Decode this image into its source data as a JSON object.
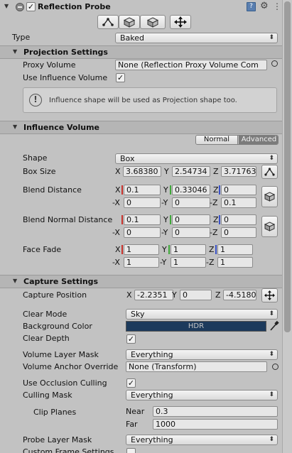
{
  "header": {
    "component_name": "Reflection Probe",
    "help_icon": "book-help-icon",
    "settings_icon": "gear-icon",
    "menu_icon": "vertical-dots-icon"
  },
  "toolbar": {
    "tools": [
      "edit-shape-icon",
      "box-icon",
      "box-icon",
      "move-arrows-icon"
    ]
  },
  "type": {
    "label": "Type",
    "value": "Baked"
  },
  "projection": {
    "title": "Projection Settings",
    "proxy_volume_label": "Proxy Volume",
    "proxy_volume_value": "None (Reflection Proxy Volume Com",
    "use_influence_label": "Use Influence Volume",
    "use_influence_checked": "✓",
    "info_text": "Influence shape will be used as Projection shape too."
  },
  "influence": {
    "title": "Influence Volume",
    "mode_normal": "Normal",
    "mode_advanced": "Advanced",
    "shape_label": "Shape",
    "shape_value": "Box",
    "box_size_label": "Box Size",
    "box_size": {
      "x_axis": "X",
      "x": "3.68380",
      "y_axis": "Y",
      "y": "2.54734",
      "z_axis": "Z",
      "z": "3.71763"
    },
    "blend_distance_label": "Blend Distance",
    "blend_distance": {
      "x_axis": "X",
      "x": "0.1",
      "y_axis": "Y",
      "y": "0.33046",
      "z_axis": "Z",
      "z": "0",
      "nx_axis": "-X",
      "nx": "0",
      "ny_axis": "-Y",
      "ny": "0",
      "nz_axis": "-Z",
      "nz": "0.1"
    },
    "blend_normal_label": "Blend Normal Distance",
    "blend_normal": {
      "x_axis": "X",
      "x": "0.1",
      "y_axis": "Y",
      "y": "0",
      "z_axis": "Z",
      "z": "0",
      "nx_axis": "-X",
      "nx": "0",
      "ny_axis": "-Y",
      "ny": "0",
      "nz_axis": "-Z",
      "nz": "0"
    },
    "face_fade_label": "Face Fade",
    "face_fade": {
      "x_axis": "X",
      "x": "1",
      "y_axis": "Y",
      "y": "1",
      "z_axis": "Z",
      "z": "1",
      "nx_axis": "-X",
      "nx": "1",
      "ny_axis": "-Y",
      "ny": "1",
      "nz_axis": "-Z",
      "nz": "1"
    }
  },
  "capture": {
    "title": "Capture Settings",
    "position_label": "Capture Position",
    "position": {
      "x_axis": "X",
      "x": "-2.2351",
      "y_axis": "Y",
      "y": "0",
      "z_axis": "Z",
      "z": "-4.5180"
    },
    "clear_mode_label": "Clear Mode",
    "clear_mode_value": "Sky",
    "background_color_label": "Background Color",
    "background_color_badge": "HDR",
    "background_color_hex": "#1c3a5c",
    "clear_depth_label": "Clear Depth",
    "clear_depth_checked": "✓",
    "volume_layer_mask_label": "Volume Layer Mask",
    "volume_layer_mask_value": "Everything",
    "volume_anchor_label": "Volume Anchor Override",
    "volume_anchor_value": "None (Transform)",
    "use_occlusion_label": "Use Occlusion Culling",
    "use_occlusion_checked": "✓",
    "culling_mask_label": "Culling Mask",
    "culling_mask_value": "Everything",
    "clip_planes_label": "Clip Planes",
    "near_label": "Near",
    "near_value": "0.3",
    "far_label": "Far",
    "far_value": "1000",
    "probe_layer_mask_label": "Probe Layer Mask",
    "probe_layer_mask_value": "Everything",
    "custom_frame_label": "Custom Frame Settings"
  },
  "colors": {
    "axis_x": "#c8302a",
    "axis_y": "#3fa83a",
    "axis_z": "#3a52c8",
    "panel_bg": "#c2c2c2",
    "header_bg": "#b5b5b5"
  }
}
